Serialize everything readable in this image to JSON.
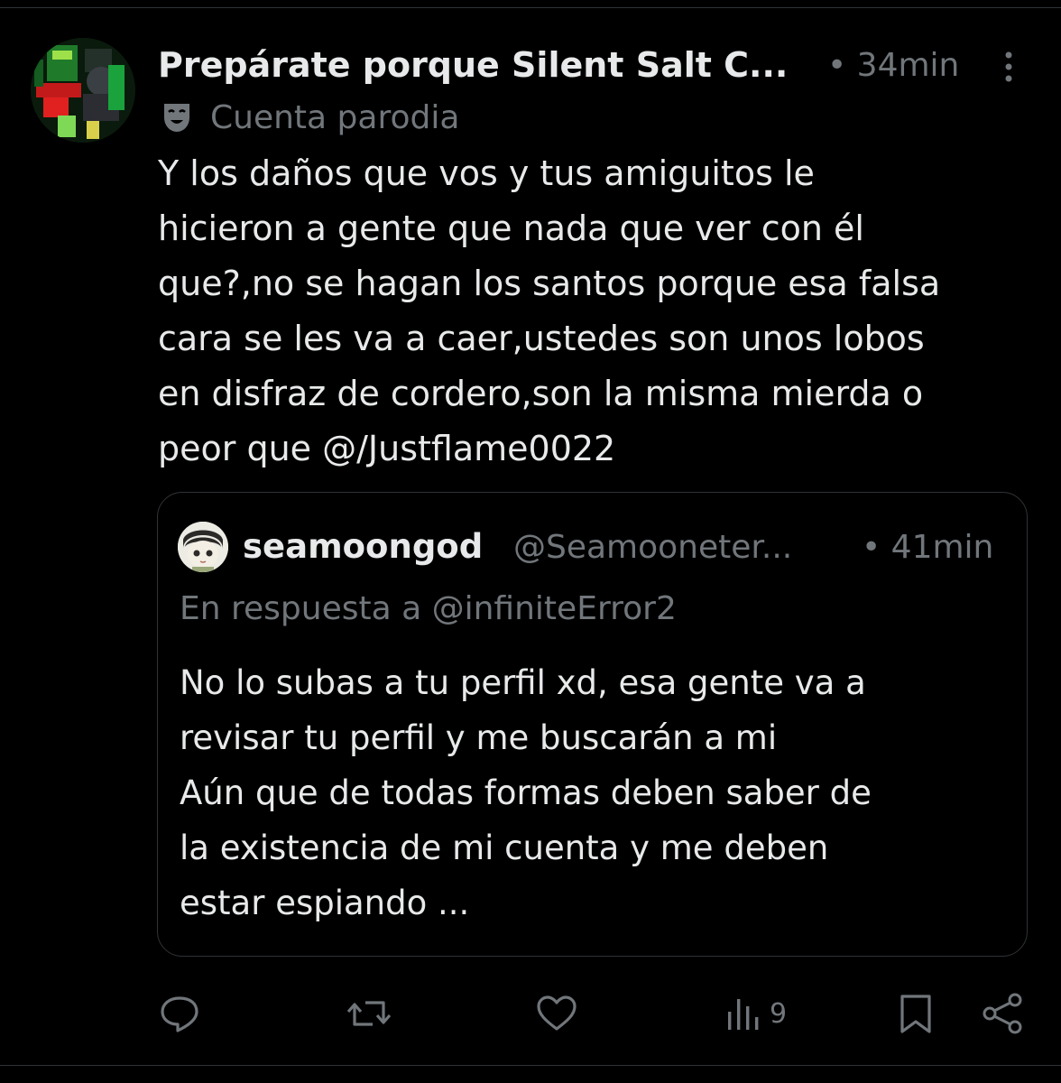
{
  "post": {
    "display_name": "Prepárate porque Silent Salt C...",
    "time": "• 34min",
    "parody_label": "Cuenta parodia",
    "text_lines": [
      "Y los daños que vos y tus amiguitos le",
      "hicieron a gente que nada que ver con él",
      "que?,no se hagan los santos porque esa falsa",
      "cara se les va a caer,ustedes son unos lobos",
      "en disfraz de cordero,son la misma mierda o",
      "peor que @/Justflame0022"
    ]
  },
  "quote": {
    "display_name": "seamoongod",
    "handle": "@Seamooneter...",
    "time": "• 41min",
    "reply_to": "En respuesta a @infiniteError2",
    "text_lines": [
      "No lo subas a tu perfil xd, esa gente va a",
      "revisar tu perfil y me buscarán a mi",
      "Aún que de todas formas deben saber de",
      "la existencia de mi cuenta y me deben",
      "estar espiando ..."
    ]
  },
  "actions": {
    "icons": [
      "reply-icon",
      "repost-icon",
      "like-icon",
      "views-icon",
      "bookmark-icon",
      "share-icon"
    ],
    "views_count": "9"
  },
  "colors": {
    "background": "#000000",
    "primary_text": "#e7e9ea",
    "secondary_text": "#71767b",
    "border": "#2f3336"
  }
}
